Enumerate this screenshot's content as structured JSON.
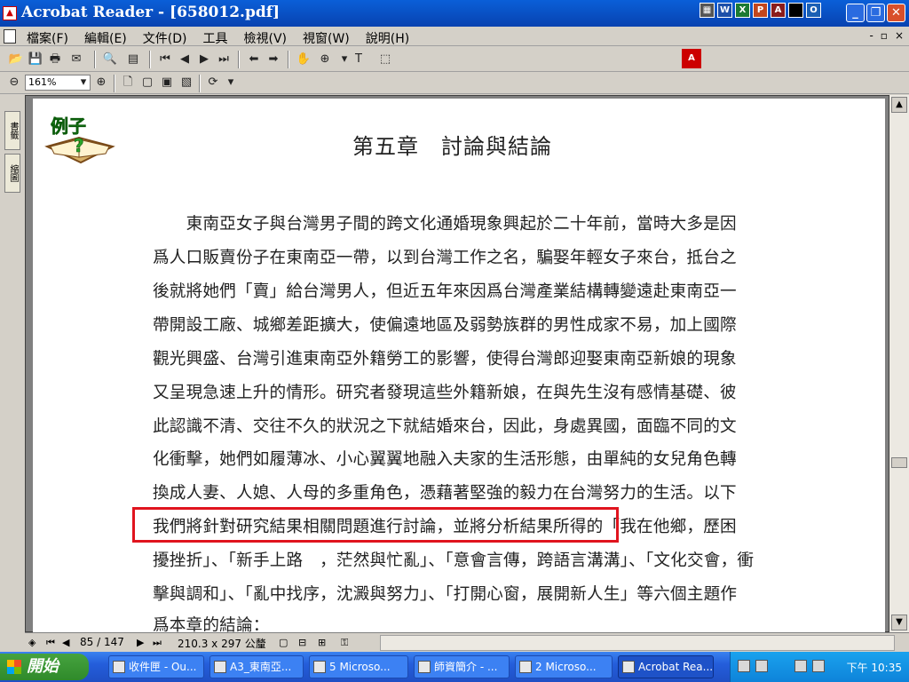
{
  "window": {
    "title": "Acrobat Reader - [658012.pdf]"
  },
  "menu": [
    "檔案(F)",
    "編輯(E)",
    "文件(D)",
    "工具",
    "檢視(V)",
    "視窗(W)",
    "說明(H)"
  ],
  "mdi_controls": [
    "-",
    "▫",
    "×"
  ],
  "zoom": {
    "value": "161%"
  },
  "nav_tabs": [
    "書籤",
    "縮圖"
  ],
  "document": {
    "badge": "例子",
    "chapter_title": "第五章　討論與結論",
    "lines": [
      "　　東南亞女子與台灣男子間的跨文化通婚現象興起於二十年前，當時大多是因",
      "爲人口販賣份子在東南亞一帶，以到台灣工作之名，騙娶年輕女子來台，抵台之",
      "後就將她們「賣」給台灣男人，但近五年來因爲台灣產業結構轉變遠赴東南亞一",
      "帶開設工廠、城鄉差距擴大，使偏遠地區及弱勢族群的男性成家不易，加上國際",
      "觀光興盛、台灣引進東南亞外籍勞工的影響，使得台灣郎迎娶東南亞新娘的現象",
      "又呈現急速上升的情形。研究者發現這些外籍新娘，在與先生沒有感情基礎、彼",
      "此認識不清、交往不久的狀況之下就結婚來台，因此，身處異國，面臨不同的文",
      "化衝擊，她們如履薄冰、小心翼翼地融入夫家的生活形態，由單純的女兒角色轉",
      "換成人妻、人媳、人母的多重角色，憑藉著堅強的毅力在台灣努力的生活。以下",
      "我們將針對研究結果相關問題進行討論，並將分析結果所得的「我在他鄉，歷困",
      "擾挫折」、「新手上路　，茫然與忙亂」、「意會言傳，跨語言溝溝」、「文化交會，衝",
      "擊與調和」、「亂中找序，沈澱與努力」、「打開心窗，展開新人生」等六個主題作",
      "爲本章的結論："
    ]
  },
  "status": {
    "page": "85 / 147",
    "size": "210.3 x 297 公釐"
  },
  "taskbar": {
    "start": "開始",
    "tasks": [
      "收件匣 - Ou...",
      "A3_東南亞...",
      "5 Microso...",
      "師資簡介 - ...",
      "2 Microso...",
      "Acrobat Rea..."
    ],
    "clock": "下午 10:35"
  },
  "colors": {
    "highlight": "#e0141e",
    "titlebar": "#0a5fd8",
    "start": "#2f8a2a"
  }
}
